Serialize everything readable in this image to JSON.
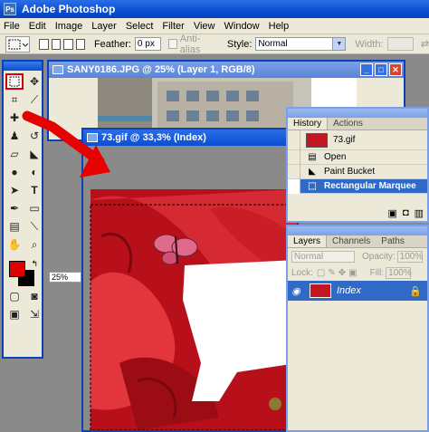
{
  "app": {
    "title": "Adobe Photoshop",
    "logo": "Ps"
  },
  "menu": [
    "File",
    "Edit",
    "Image",
    "Layer",
    "Select",
    "Filter",
    "View",
    "Window",
    "Help"
  ],
  "options": {
    "feather_label": "Feather:",
    "feather_value": "0 px",
    "antialias_label": "Anti-alias",
    "style_label": "Style:",
    "style_value": "Normal",
    "width_label": "Width:"
  },
  "doc_back": {
    "title": "SANY0186.JPG @ 25% (Layer 1, RGB/8)"
  },
  "doc_front": {
    "title": "73.gif @ 33,3% (Index)",
    "zoom": "25%"
  },
  "history": {
    "tabs": [
      "History",
      "Actions"
    ],
    "snapshot": "73.gif",
    "items": [
      "Open",
      "Paint Bucket",
      "Rectangular Marquee"
    ]
  },
  "layers": {
    "tabs": [
      "Layers",
      "Channels",
      "Paths"
    ],
    "blend": "Normal",
    "opacity_label": "Opacity:",
    "opacity_value": "100%",
    "lock_label": "Lock:",
    "fill_label": "Fill:",
    "fill_value": "100%",
    "layer_name": "Index"
  },
  "colors": {
    "foreground": "#e00000",
    "background": "#000000",
    "accent": "#0a4fd3",
    "annotation": "#e60000"
  }
}
